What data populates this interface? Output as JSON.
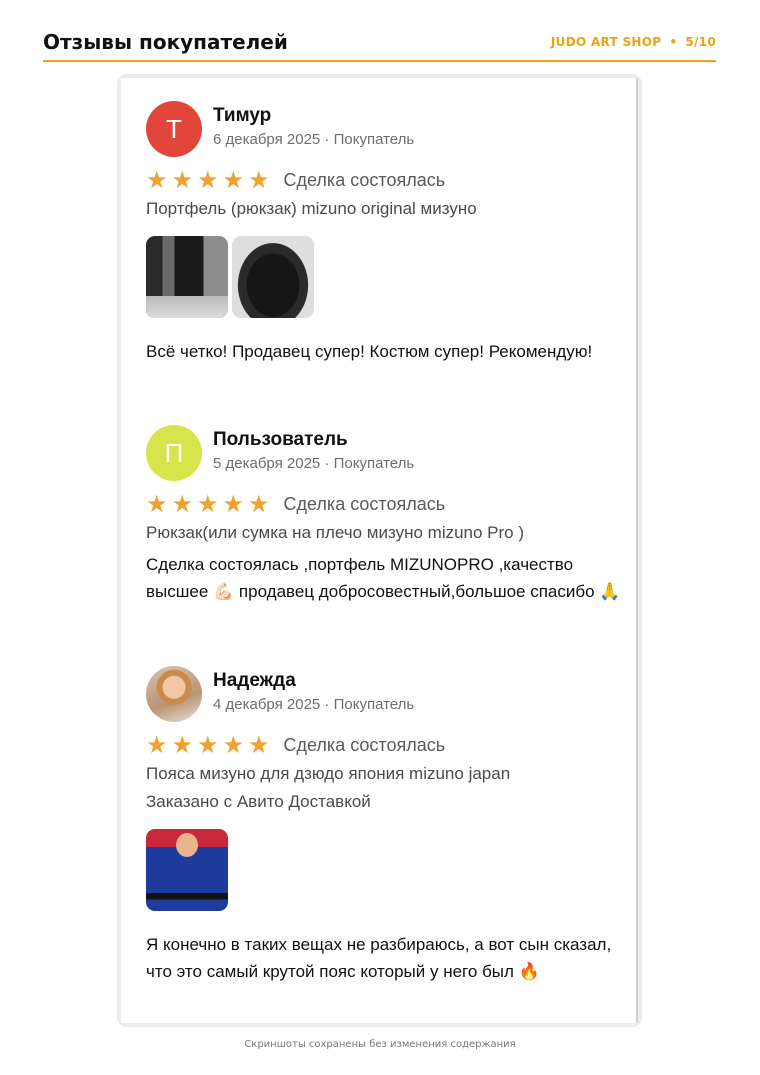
{
  "header": {
    "title": "Отзывы покупателей",
    "shop": "JUDO ART SHOP",
    "separator": "•",
    "page": "5/10"
  },
  "reviews": [
    {
      "avatar_letter": "Т",
      "avatar_color": "#e0463a",
      "name": "Тимур",
      "date": "6 декабря 2025 · Покупатель",
      "rating": 5,
      "deal_status": "Сделка состоялась",
      "product": "Портфель (рюкзак) mizuno original мизуно",
      "comment": "Всё четко! Продавец супер! Костюм супер! Рекомендую!",
      "photos": [
        "photo-1",
        "photo-2"
      ]
    },
    {
      "avatar_letter": "П",
      "avatar_color": "#d6e64a",
      "name": "Пользователь",
      "date": "5 декабря 2025 · Покупатель",
      "rating": 5,
      "deal_status": "Сделка состоялась",
      "product": "Рюкзак(или сумка на плечо мизуно mizuno Pro )",
      "comment": "Сделка состоялась ,портфель MIZUNOPRO ,качество высшее 💪🏻 продавец добросовестный,большое спасибо 🙏"
    },
    {
      "avatar_letter": "",
      "name": "Надежда",
      "date": "4 декабря 2025 · Покупатель",
      "rating": 5,
      "deal_status": "Сделка состоялась",
      "product": "Пояса мизуно для дзюдо япония mizuno japan\nЗаказано с Авито Доставкой",
      "product_lines": [
        "Пояса мизуно для дзюдо япония mizuno japan",
        "Заказано с Авито Доставкой"
      ],
      "comment": "Я конечно в таких вещах не разбираюсь, а вот сын сказал, что это самый крутой пояс который у него был 🔥",
      "photos": [
        "photo-1"
      ]
    }
  ],
  "star_glyph": "★",
  "star_color": "#f2a12e",
  "accent_color": "#e8a317",
  "footer": {
    "caption": "Скриншоты сохранены без изменения содержания"
  }
}
